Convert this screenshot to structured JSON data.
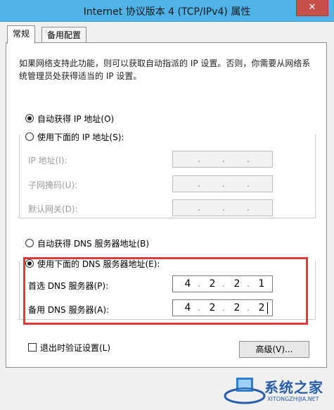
{
  "window": {
    "title": "Internet 协议版本 4 (TCP/IPv4) 属性",
    "close_label": "✕"
  },
  "tabs": [
    {
      "label": "常规",
      "active": true
    },
    {
      "label": "备用配置",
      "active": false
    }
  ],
  "description": "如果网络支持此功能，则可以获取自动指派的 IP 设置。否则，你需要从网络系统管理员处获得适当的 IP 设置。",
  "ip_section": {
    "auto_label": "自动获得 IP 地址(O)",
    "auto_checked": true,
    "manual_label": "使用下面的 IP 地址(S):",
    "manual_checked": false,
    "fields": [
      {
        "label": "IP 地址(I):",
        "value": "",
        "enabled": false
      },
      {
        "label": "子网掩码(U):",
        "value": "",
        "enabled": false
      },
      {
        "label": "默认网关(D):",
        "value": "",
        "enabled": false
      }
    ]
  },
  "dns_section": {
    "auto_label": "自动获得 DNS 服务器地址(B)",
    "auto_checked": false,
    "manual_label": "使用下面的 DNS 服务器地址(E):",
    "manual_checked": true,
    "preferred": {
      "label": "首选 DNS 服务器(P):",
      "octets": [
        "4",
        "2",
        "2",
        "1"
      ]
    },
    "alternate": {
      "label": "备用 DNS 服务器(A):",
      "octets": [
        "4",
        "2",
        "2",
        "2"
      ]
    }
  },
  "validate_label": "退出时验证设置(L)",
  "validate_checked": false,
  "advanced_label": "高级(V)...",
  "watermark": {
    "text": "系统之家",
    "url": "XITONGZHIJIA.NET"
  },
  "colors": {
    "titlebar": "#4fb3e8",
    "close_button": "#c7504a",
    "highlight": "#e03a3a",
    "watermark": "#2a5fa8"
  }
}
